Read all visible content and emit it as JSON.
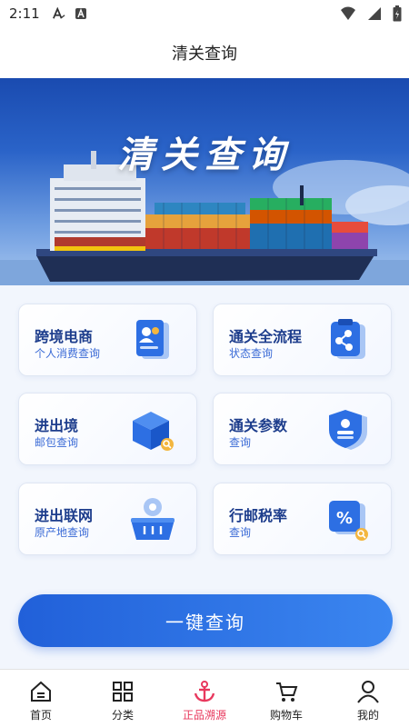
{
  "status_bar": {
    "time": "2:11"
  },
  "header": {
    "title": "清关查询"
  },
  "banner": {
    "title": "清关查询"
  },
  "cards": [
    {
      "title": "跨境电商",
      "subtitle": "个人消费查询",
      "icon": "document-person-icon"
    },
    {
      "title": "通关全流程",
      "subtitle": "状态查询",
      "icon": "clipboard-share-icon"
    },
    {
      "title": "进出境",
      "subtitle": "邮包查询",
      "icon": "package-search-icon"
    },
    {
      "title": "通关参数",
      "subtitle": "查询",
      "icon": "shield-id-icon"
    },
    {
      "title": "进出联网",
      "subtitle": "原产地查询",
      "icon": "basket-location-icon"
    },
    {
      "title": "行邮税率",
      "subtitle": "查询",
      "icon": "percent-search-icon"
    }
  ],
  "query_button": {
    "label": "一键查询"
  },
  "tabbar": {
    "items": [
      {
        "label": "首页",
        "icon": "home-icon"
      },
      {
        "label": "分类",
        "icon": "grid-icon"
      },
      {
        "label": "正品溯源",
        "icon": "anchor-icon"
      },
      {
        "label": "购物车",
        "icon": "cart-icon"
      },
      {
        "label": "我的",
        "icon": "person-icon"
      }
    ],
    "active_index": 2
  },
  "colors": {
    "accent": "#2a6ae0",
    "active_tab": "#e8385d",
    "card_title": "#1d3d8c"
  }
}
